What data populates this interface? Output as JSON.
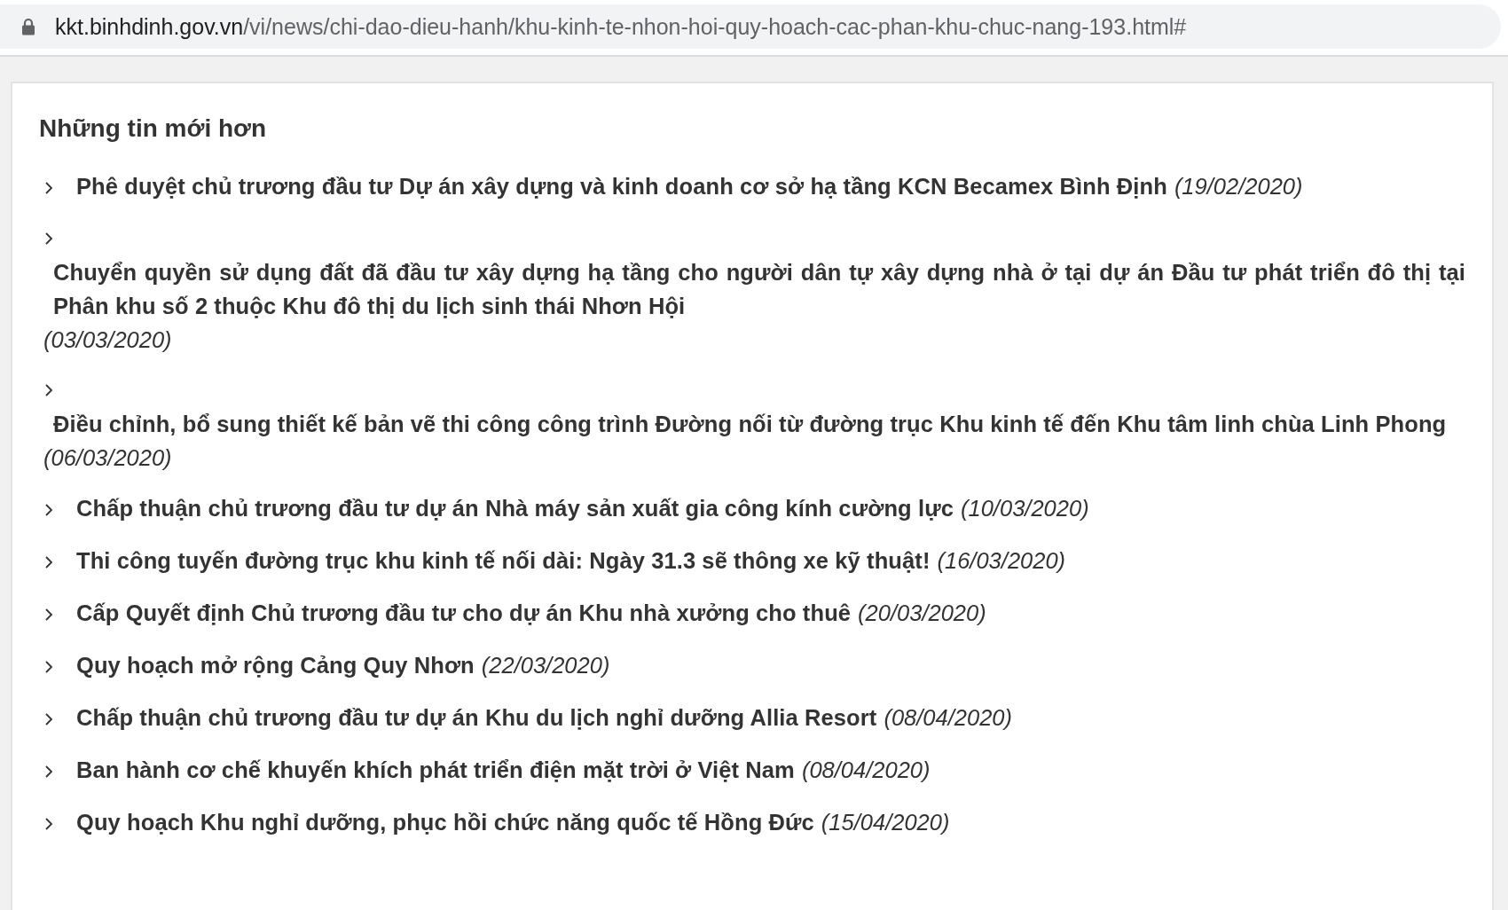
{
  "address_bar": {
    "host": "kkt.binhdinh.gov.vn",
    "path": "/vi/news/chi-dao-dieu-hanh/khu-kinh-te-nhon-hoi-quy-hoach-cac-phan-khu-chuc-nang-193.html#"
  },
  "section": {
    "title": "Những tin mới hơn",
    "items": [
      {
        "kind": "inline",
        "title": "Phê duyệt chủ trương đầu tư Dự án xây dựng và kinh doanh cơ sở hạ tầng KCN Becamex Bình Định",
        "date": "(19/02/2020)"
      },
      {
        "kind": "block",
        "title": "Chuyển quyền sử dụng đất đã đầu tư xây dựng hạ tầng cho người dân tự xây dựng nhà ở tại dự án Đầu tư phát triển đô thị tại Phân khu số 2 thuộc Khu đô thị du lịch sinh thái Nhơn Hội",
        "date": "(03/03/2020)"
      },
      {
        "kind": "block",
        "title": "Điều chỉnh, bổ sung thiết kế bản vẽ thi công công trình Đường nối từ đường trục Khu kinh tế đến Khu tâm linh chùa Linh Phong",
        "date": "(06/03/2020)"
      },
      {
        "kind": "inline",
        "title": "Chấp thuận chủ trương đầu tư dự án Nhà máy sản xuất gia công kính cường lực",
        "date": "(10/03/2020)"
      },
      {
        "kind": "inline",
        "title": "Thi công tuyến đường trục khu kinh tế nối dài: Ngày 31.3 sẽ thông xe kỹ thuật!",
        "date": "(16/03/2020)"
      },
      {
        "kind": "inline",
        "title": "Cấp Quyết định Chủ trương đầu tư cho dự án Khu nhà xưởng cho thuê",
        "date": "(20/03/2020)"
      },
      {
        "kind": "inline",
        "title": "Quy hoạch mở rộng Cảng Quy Nhơn",
        "date": "(22/03/2020)"
      },
      {
        "kind": "inline",
        "title": "Chấp thuận chủ trương đầu tư dự án Khu du lịch nghỉ dưỡng Allia Resort",
        "date": "(08/04/2020)"
      },
      {
        "kind": "inline",
        "title": "Ban hành cơ chế khuyến khích phát triển điện mặt trời ở Việt Nam",
        "date": "(08/04/2020)"
      },
      {
        "kind": "inline",
        "title": "Quy hoạch Khu nghỉ dưỡng, phục hồi chức năng quốc tế Hồng Đức",
        "date": "(15/04/2020)"
      }
    ]
  }
}
